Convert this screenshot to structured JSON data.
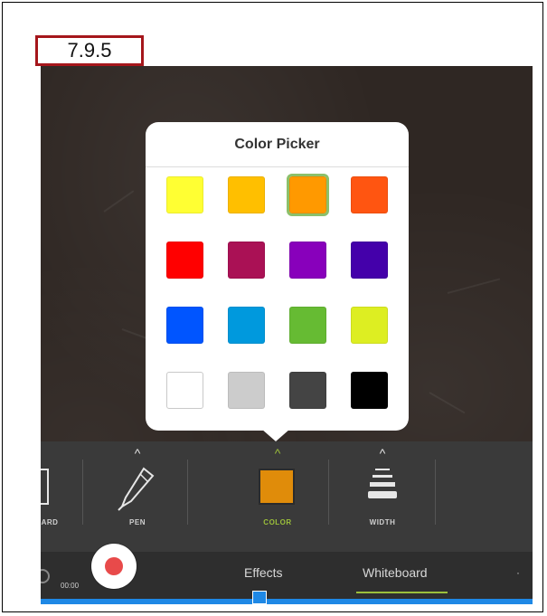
{
  "section_label": "7.9.5",
  "color_picker": {
    "title": "Color Picker",
    "swatches": [
      {
        "name": "yellow",
        "color": "#FFFF33",
        "selected": false
      },
      {
        "name": "amber",
        "color": "#FFBF00",
        "selected": false
      },
      {
        "name": "orange",
        "color": "#FF9900",
        "selected": true
      },
      {
        "name": "red-orange",
        "color": "#FF5511",
        "selected": false
      },
      {
        "name": "red",
        "color": "#FF0000",
        "selected": false
      },
      {
        "name": "crimson",
        "color": "#AA1155",
        "selected": false
      },
      {
        "name": "purple",
        "color": "#8800BB",
        "selected": false
      },
      {
        "name": "indigo",
        "color": "#4400AA",
        "selected": false
      },
      {
        "name": "blue",
        "color": "#0055FF",
        "selected": false
      },
      {
        "name": "sky-blue",
        "color": "#0099DD",
        "selected": false
      },
      {
        "name": "green",
        "color": "#66BB33",
        "selected": false
      },
      {
        "name": "lime",
        "color": "#DDEE22",
        "selected": false
      },
      {
        "name": "white",
        "color": "#FFFFFF",
        "selected": false
      },
      {
        "name": "light-gray",
        "color": "#CCCCCC",
        "selected": false
      },
      {
        "name": "dark-gray",
        "color": "#444444",
        "selected": false
      },
      {
        "name": "black",
        "color": "#000000",
        "selected": false
      }
    ]
  },
  "toolbar": {
    "board_label": "ARD",
    "pen_label": "PEN",
    "color_label": "COLOR",
    "width_label": "WIDTH",
    "current_color": "#E08C0A",
    "active_color": "#9BBF3A",
    "icons": [
      "board-icon",
      "pen-icon",
      "color-swatch-icon",
      "width-lines-icon"
    ]
  },
  "bottom_bar": {
    "timer": "00:00",
    "effects_tab": "Effects",
    "whiteboard_tab": "Whiteboard",
    "record_color": "#E84A4A",
    "progress_color": "#1E88E5"
  }
}
